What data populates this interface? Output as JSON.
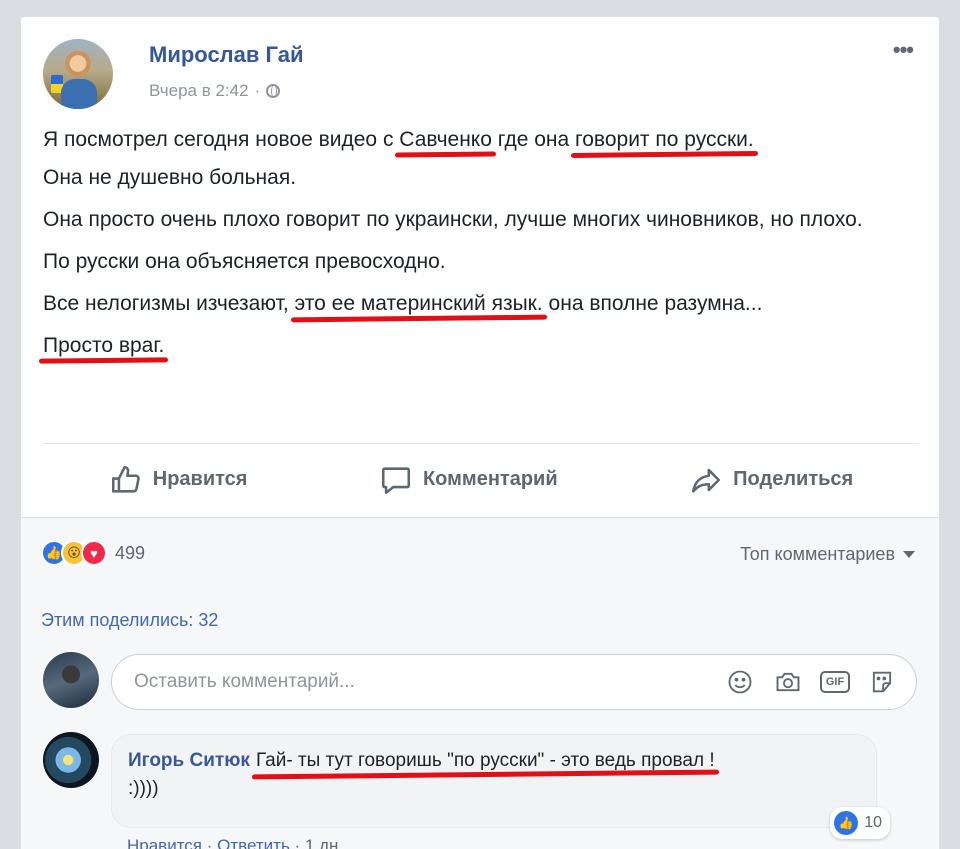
{
  "post": {
    "author": "Мирослав Гай",
    "timestamp": "Вчера в 2:42",
    "separator": "·",
    "more_icon": "ellipsis-icon",
    "paragraphs": {
      "p1_a": "Я посмотрел сегодня новое видео с ",
      "p1_h1": "Савченко",
      "p1_b": " где она ",
      "p1_h2": "говорит по русски.",
      "p2": "Она не душевно больная.",
      "p3": "Она просто очень плохо говорит по украински, лучше многих чиновников, но плохо.",
      "p4": "По русски она объясняется превосходно.",
      "p5_a": "Все нелогизмы изчезают, ",
      "p5_h": "это ее материнский язык.",
      "p5_b": " она вполне разумна...",
      "p6_h": "Просто враг."
    }
  },
  "actions": {
    "like": "Нравится",
    "comment": "Комментарий",
    "share": "Поделиться"
  },
  "reactions": {
    "count": "499",
    "top_comments": "Топ комментариев"
  },
  "shared": "Этим поделились: 32",
  "composer": {
    "placeholder": "Оставить комментарий..."
  },
  "comment": {
    "author": "Игорь Ситюк",
    "text": "Гай- ты тут говоришь \"по русски\" - это ведь провал !",
    "text2": ":))))",
    "likes": "10",
    "like_action": "Нравится",
    "reply_action": "Ответить",
    "time": "1 дн."
  },
  "colors": {
    "link_blue": "#365899",
    "highlight_red": "#e01016",
    "like_blue": "#2d74e8"
  }
}
